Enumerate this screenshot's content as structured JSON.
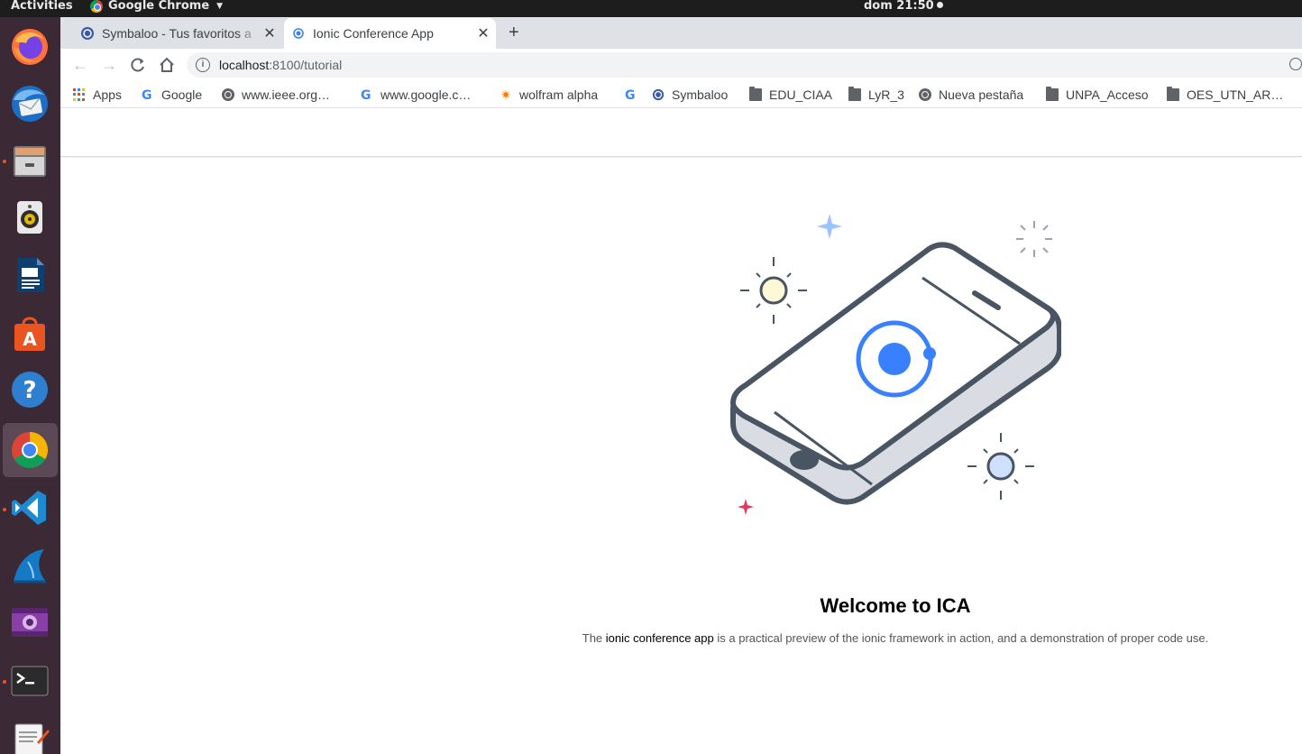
{
  "topbar": {
    "activities": "Activities",
    "app_menu": "Google Chrome",
    "clock": "dom 21:50"
  },
  "dock": {
    "items": [
      {
        "name": "firefox-icon",
        "running": false
      },
      {
        "name": "thunderbird-icon",
        "running": false
      },
      {
        "name": "files-icon",
        "running": true
      },
      {
        "name": "rhythmbox-icon",
        "running": false
      },
      {
        "name": "writer-icon",
        "running": false
      },
      {
        "name": "software-center-icon",
        "running": false
      },
      {
        "name": "help-icon",
        "running": false
      },
      {
        "name": "chrome-icon",
        "running": true,
        "active": true
      },
      {
        "name": "vscode-icon",
        "running": true
      },
      {
        "name": "wireshark-icon",
        "running": false
      },
      {
        "name": "video-editor-icon",
        "running": false
      },
      {
        "name": "terminal-icon",
        "running": true
      },
      {
        "name": "text-editor-icon",
        "running": false
      }
    ]
  },
  "tabs": [
    {
      "title": "Symbaloo - Tus favoritos a",
      "active": false
    },
    {
      "title": "Ionic Conference App",
      "active": true
    }
  ],
  "toolbar": {
    "url_host": "localhost",
    "url_path": ":8100/tutorial"
  },
  "bookmarks": [
    {
      "label": "Apps",
      "icon": "apps-grid-icon"
    },
    {
      "label": "Google",
      "icon": "google-icon"
    },
    {
      "label": "www.ieee.org…",
      "icon": "globe-icon"
    },
    {
      "label": "www.google.c…",
      "icon": "google-icon"
    },
    {
      "label": "wolfram alpha",
      "icon": "wolfram-icon"
    },
    {
      "label": "",
      "icon": "google-icon"
    },
    {
      "label": "Symbaloo",
      "icon": "symbaloo-icon"
    },
    {
      "label": "EDU_CIAA",
      "icon": "folder-icon"
    },
    {
      "label": "LyR_3",
      "icon": "folder-icon"
    },
    {
      "label": "Nueva pestaña",
      "icon": "globe-icon"
    },
    {
      "label": "UNPA_Acceso",
      "icon": "folder-icon"
    },
    {
      "label": "OES_UTN_AR…",
      "icon": "folder-icon"
    }
  ],
  "page": {
    "welcome_title": "Welcome to ICA",
    "welcome_prefix": "The ",
    "welcome_highlight": "ionic conference app",
    "welcome_suffix": " is a practical preview of the ionic framework in action, and a demonstration of proper code use."
  },
  "colors": {
    "ionic_blue": "#3880ff",
    "phone_outline": "#4a5563",
    "dock_bg": "#3b2a35",
    "accent_dot": "#e95420"
  }
}
